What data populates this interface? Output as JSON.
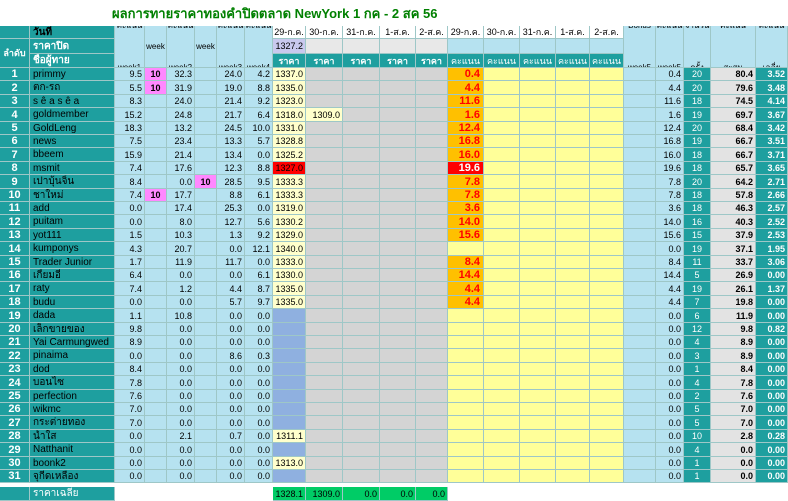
{
  "title": "ผลการทายราคาทองคำปิดตลาด NewYork 1 กค - 2 สค 56",
  "header": {
    "wanthi": "วันที่",
    "lamdap": "ลำดับ",
    "close_price": "ราคาปิด",
    "player_name": "ชื่อผู้ทาย",
    "score_week1": "คะแนน week1",
    "bonus_week2": "Bonus week 2",
    "score_week2": "คะแนน week2",
    "bonus_week3": "Bonus week 3",
    "score_week3": "คะแนน week3",
    "score_week4": "คะแนน week4",
    "bonus_week5": "Bonus week5",
    "score_week5": "คะแนน week5",
    "count": "จำนวนครั้ง",
    "total": "คะแนนสะสม",
    "avg": "คะแนนเฉลี่ย",
    "price_label": "ราคา",
    "points_label": "คะแนน",
    "dates": [
      "29-ก.ค.",
      "30-ก.ค.",
      "31-ก.ค.",
      "1-ส.ค.",
      "2-ส.ค."
    ],
    "close_values": [
      "1327.2",
      "",
      "",
      "",
      ""
    ]
  },
  "rows": [
    {
      "rank": "1",
      "name": "primmy",
      "w1": "9.5",
      "b2": "10",
      "w2": "32.3",
      "b3": "",
      "w3": "24.0",
      "w4": "4.2",
      "p": [
        "1337.0",
        "",
        "",
        "",
        ""
      ],
      "s": [
        "0.4",
        "",
        "",
        "",
        ""
      ],
      "w5": "0.4",
      "cnt": "20",
      "tot": "80.4",
      "avg": "3.52"
    },
    {
      "rank": "2",
      "name": "ตก-รถ",
      "w1": "5.5",
      "b2": "10",
      "w2": "31.9",
      "b3": "",
      "w3": "19.0",
      "w4": "8.8",
      "p": [
        "1335.0",
        "",
        "",
        "",
        ""
      ],
      "s": [
        "4.4",
        "",
        "",
        "",
        ""
      ],
      "w5": "4.4",
      "cnt": "20",
      "tot": "79.6",
      "avg": "3.48"
    },
    {
      "rank": "3",
      "name": "s ê a s ê a",
      "w1": "8.3",
      "b2": "",
      "w2": "24.0",
      "b3": "",
      "w3": "21.4",
      "w4": "9.2",
      "p": [
        "1323.0",
        "",
        "",
        "",
        ""
      ],
      "s": [
        "11.6",
        "",
        "",
        "",
        ""
      ],
      "w5": "11.6",
      "cnt": "18",
      "tot": "74.5",
      "avg": "4.14"
    },
    {
      "rank": "4",
      "name": "goldmember",
      "w1": "15.2",
      "b2": "",
      "w2": "24.8",
      "b3": "",
      "w3": "21.7",
      "w4": "6.4",
      "p": [
        "1318.0",
        "1309.0",
        "",
        "",
        ""
      ],
      "s": [
        "1.6",
        "",
        "",
        "",
        ""
      ],
      "w5": "1.6",
      "cnt": "19",
      "tot": "69.7",
      "avg": "3.67"
    },
    {
      "rank": "5",
      "name": "GoldLeng",
      "w1": "18.3",
      "b2": "",
      "w2": "13.2",
      "b3": "",
      "w3": "24.5",
      "w4": "10.0",
      "p": [
        "1331.0",
        "",
        "",
        "",
        ""
      ],
      "s": [
        "12.4",
        "",
        "",
        "",
        ""
      ],
      "w5": "12.4",
      "cnt": "20",
      "tot": "68.4",
      "avg": "3.42"
    },
    {
      "rank": "6",
      "name": "news",
      "w1": "7.5",
      "b2": "",
      "w2": "23.4",
      "b3": "",
      "w3": "13.3",
      "w4": "5.7",
      "p": [
        "1328.8",
        "",
        "",
        "",
        ""
      ],
      "s": [
        "16.8",
        "",
        "",
        "",
        ""
      ],
      "w5": "16.8",
      "cnt": "19",
      "tot": "66.7",
      "avg": "3.51"
    },
    {
      "rank": "7",
      "name": "bbeem",
      "w1": "15.9",
      "b2": "",
      "w2": "21.4",
      "b3": "",
      "w3": "13.4",
      "w4": "0.0",
      "p": [
        "1325.2",
        "",
        "",
        "",
        ""
      ],
      "s": [
        "16.0",
        "",
        "",
        "",
        ""
      ],
      "w5": "16.0",
      "cnt": "18",
      "tot": "66.7",
      "avg": "3.71"
    },
    {
      "rank": "8",
      "name": "msmit",
      "w1": "7.4",
      "b2": "",
      "w2": "17.6",
      "b3": "",
      "w3": "12.3",
      "w4": "8.8",
      "p": [
        "1327.0",
        "",
        "",
        "",
        ""
      ],
      "s": [
        "19.6",
        "",
        "",
        "",
        ""
      ],
      "w5": "19.6",
      "cnt": "18",
      "tot": "65.7",
      "avg": "3.65",
      "hit": true
    },
    {
      "rank": "9",
      "name": "เปาบุ้นจิ้น",
      "w1": "8.4",
      "b2": "",
      "w2": "0.0",
      "b3": "10",
      "w3": "28.5",
      "w4": "9.5",
      "p": [
        "1333.3",
        "",
        "",
        "",
        ""
      ],
      "s": [
        "7.8",
        "",
        "",
        "",
        ""
      ],
      "w5": "7.8",
      "cnt": "20",
      "tot": "64.2",
      "avg": "2.71"
    },
    {
      "rank": "10",
      "name": "ชาใหม่",
      "w1": "7.4",
      "b2": "10",
      "w2": "17.7",
      "b3": "",
      "w3": "8.8",
      "w4": "6.1",
      "p": [
        "1333.3",
        "",
        "",
        "",
        ""
      ],
      "s": [
        "7.8",
        "",
        "",
        "",
        ""
      ],
      "w5": "7.8",
      "cnt": "18",
      "tot": "57.8",
      "avg": "2.66"
    },
    {
      "rank": "11",
      "name": "add",
      "w1": "0.0",
      "b2": "",
      "w2": "17.4",
      "b3": "",
      "w3": "25.3",
      "w4": "0.0",
      "p": [
        "1319.0",
        "",
        "",
        "",
        ""
      ],
      "s": [
        "3.6",
        "",
        "",
        "",
        ""
      ],
      "w5": "3.6",
      "cnt": "18",
      "tot": "46.3",
      "avg": "2.57"
    },
    {
      "rank": "12",
      "name": "puitam",
      "w1": "0.0",
      "b2": "",
      "w2": "8.0",
      "b3": "",
      "w3": "12.7",
      "w4": "5.6",
      "p": [
        "1330.2",
        "",
        "",
        "",
        ""
      ],
      "s": [
        "14.0",
        "",
        "",
        "",
        ""
      ],
      "w5": "14.0",
      "cnt": "16",
      "tot": "40.3",
      "avg": "2.52"
    },
    {
      "rank": "13",
      "name": "yot111",
      "w1": "1.5",
      "b2": "",
      "w2": "10.3",
      "b3": "",
      "w3": "1.3",
      "w4": "9.2",
      "p": [
        "1329.0",
        "",
        "",
        "",
        ""
      ],
      "s": [
        "15.6",
        "",
        "",
        "",
        ""
      ],
      "w5": "15.6",
      "cnt": "15",
      "tot": "37.9",
      "avg": "2.53"
    },
    {
      "rank": "14",
      "name": "kumponys",
      "w1": "4.3",
      "b2": "",
      "w2": "20.7",
      "b3": "",
      "w3": "0.0",
      "w4": "12.1",
      "p": [
        "1340.0",
        "",
        "",
        "",
        ""
      ],
      "s": [
        "",
        "",
        "",
        "",
        ""
      ],
      "w5": "0.0",
      "cnt": "19",
      "tot": "37.1",
      "avg": "1.95"
    },
    {
      "rank": "15",
      "name": "Trader Junior",
      "w1": "1.7",
      "b2": "",
      "w2": "11.9",
      "b3": "",
      "w3": "11.7",
      "w4": "0.0",
      "p": [
        "1333.0",
        "",
        "",
        "",
        ""
      ],
      "s": [
        "8.4",
        "",
        "",
        "",
        ""
      ],
      "w5": "8.4",
      "cnt": "11",
      "tot": "33.7",
      "avg": "3.06"
    },
    {
      "rank": "16",
      "name": "เกี้ยมอี๋",
      "w1": "6.4",
      "b2": "",
      "w2": "0.0",
      "b3": "",
      "w3": "0.0",
      "w4": "6.1",
      "p": [
        "1330.0",
        "",
        "",
        "",
        ""
      ],
      "s": [
        "14.4",
        "",
        "",
        "",
        ""
      ],
      "w5": "14.4",
      "cnt": "5",
      "tot": "26.9",
      "avg": "0.00"
    },
    {
      "rank": "17",
      "name": "raty",
      "w1": "7.4",
      "b2": "",
      "w2": "1.2",
      "b3": "",
      "w3": "4.4",
      "w4": "8.7",
      "p": [
        "1335.0",
        "",
        "",
        "",
        ""
      ],
      "s": [
        "4.4",
        "",
        "",
        "",
        ""
      ],
      "w5": "4.4",
      "cnt": "19",
      "tot": "26.1",
      "avg": "1.37"
    },
    {
      "rank": "18",
      "name": "budu",
      "w1": "0.0",
      "b2": "",
      "w2": "0.0",
      "b3": "",
      "w3": "5.7",
      "w4": "9.7",
      "p": [
        "1335.0",
        "",
        "",
        "",
        ""
      ],
      "s": [
        "4.4",
        "",
        "",
        "",
        ""
      ],
      "w5": "4.4",
      "cnt": "7",
      "tot": "19.8",
      "avg": "0.00"
    },
    {
      "rank": "19",
      "name": "dada",
      "w1": "1.1",
      "b2": "",
      "w2": "10.8",
      "b3": "",
      "w3": "0.0",
      "w4": "0.0",
      "p": [
        "",
        "",
        "",
        "",
        ""
      ],
      "s": [
        "",
        "",
        "",
        "",
        ""
      ],
      "w5": "0.0",
      "cnt": "6",
      "tot": "11.9",
      "avg": "0.00"
    },
    {
      "rank": "20",
      "name": "เล็กขายของ",
      "w1": "9.8",
      "b2": "",
      "w2": "0.0",
      "b3": "",
      "w3": "0.0",
      "w4": "0.0",
      "p": [
        "",
        "",
        "",
        "",
        ""
      ],
      "s": [
        "",
        "",
        "",
        "",
        ""
      ],
      "w5": "0.0",
      "cnt": "12",
      "tot": "9.8",
      "avg": "0.82"
    },
    {
      "rank": "21",
      "name": "Yai Carmungwed",
      "w1": "8.9",
      "b2": "",
      "w2": "0.0",
      "b3": "",
      "w3": "0.0",
      "w4": "0.0",
      "p": [
        "",
        "",
        "",
        "",
        ""
      ],
      "s": [
        "",
        "",
        "",
        "",
        ""
      ],
      "w5": "0.0",
      "cnt": "4",
      "tot": "8.9",
      "avg": "0.00"
    },
    {
      "rank": "22",
      "name": "pinaima",
      "w1": "0.0",
      "b2": "",
      "w2": "0.0",
      "b3": "",
      "w3": "8.6",
      "w4": "0.3",
      "p": [
        "",
        "",
        "",
        "",
        ""
      ],
      "s": [
        "",
        "",
        "",
        "",
        ""
      ],
      "w5": "0.0",
      "cnt": "3",
      "tot": "8.9",
      "avg": "0.00"
    },
    {
      "rank": "23",
      "name": "dod",
      "w1": "8.4",
      "b2": "",
      "w2": "0.0",
      "b3": "",
      "w3": "0.0",
      "w4": "0.0",
      "p": [
        "",
        "",
        "",
        "",
        ""
      ],
      "s": [
        "",
        "",
        "",
        "",
        ""
      ],
      "w5": "0.0",
      "cnt": "1",
      "tot": "8.4",
      "avg": "0.00"
    },
    {
      "rank": "24",
      "name": "บอนไซ",
      "w1": "7.8",
      "b2": "",
      "w2": "0.0",
      "b3": "",
      "w3": "0.0",
      "w4": "0.0",
      "p": [
        "",
        "",
        "",
        "",
        ""
      ],
      "s": [
        "",
        "",
        "",
        "",
        ""
      ],
      "w5": "0.0",
      "cnt": "4",
      "tot": "7.8",
      "avg": "0.00"
    },
    {
      "rank": "25",
      "name": "perfection",
      "w1": "7.6",
      "b2": "",
      "w2": "0.0",
      "b3": "",
      "w3": "0.0",
      "w4": "0.0",
      "p": [
        "",
        "",
        "",
        "",
        ""
      ],
      "s": [
        "",
        "",
        "",
        "",
        ""
      ],
      "w5": "0.0",
      "cnt": "2",
      "tot": "7.6",
      "avg": "0.00"
    },
    {
      "rank": "26",
      "name": "wikmc",
      "w1": "7.0",
      "b2": "",
      "w2": "0.0",
      "b3": "",
      "w3": "0.0",
      "w4": "0.0",
      "p": [
        "",
        "",
        "",
        "",
        ""
      ],
      "s": [
        "",
        "",
        "",
        "",
        ""
      ],
      "w5": "0.0",
      "cnt": "5",
      "tot": "7.0",
      "avg": "0.00"
    },
    {
      "rank": "27",
      "name": "กระต่ายทอง",
      "w1": "7.0",
      "b2": "",
      "w2": "0.0",
      "b3": "",
      "w3": "0.0",
      "w4": "0.0",
      "p": [
        "",
        "",
        "",
        "",
        ""
      ],
      "s": [
        "",
        "",
        "",
        "",
        ""
      ],
      "w5": "0.0",
      "cnt": "5",
      "tot": "7.0",
      "avg": "0.00"
    },
    {
      "rank": "28",
      "name": "น้ำใส",
      "w1": "0.0",
      "b2": "",
      "w2": "2.1",
      "b3": "",
      "w3": "0.7",
      "w4": "0.0",
      "p": [
        "1311.1",
        "",
        "",
        "",
        ""
      ],
      "s": [
        "",
        "",
        "",
        "",
        ""
      ],
      "w5": "0.0",
      "cnt": "10",
      "tot": "2.8",
      "avg": "0.28"
    },
    {
      "rank": "29",
      "name": "Natthanit",
      "w1": "0.0",
      "b2": "",
      "w2": "0.0",
      "b3": "",
      "w3": "0.0",
      "w4": "0.0",
      "p": [
        "",
        "",
        "",
        "",
        ""
      ],
      "s": [
        "",
        "",
        "",
        "",
        ""
      ],
      "w5": "0.0",
      "cnt": "4",
      "tot": "0.0",
      "avg": "0.00"
    },
    {
      "rank": "30",
      "name": "boonk2",
      "w1": "0.0",
      "b2": "",
      "w2": "0.0",
      "b3": "",
      "w3": "0.0",
      "w4": "0.0",
      "p": [
        "1313.0",
        "",
        "",
        "",
        ""
      ],
      "s": [
        "",
        "",
        "",
        "",
        ""
      ],
      "w5": "0.0",
      "cnt": "1",
      "tot": "0.0",
      "avg": "0.00"
    },
    {
      "rank": "31",
      "name": "จุกีดเหลือง",
      "w1": "0.0",
      "b2": "",
      "w2": "0.0",
      "b3": "",
      "w3": "0.0",
      "w4": "0.0",
      "p": [
        "",
        "",
        "",
        "",
        ""
      ],
      "s": [
        "",
        "",
        "",
        "",
        ""
      ],
      "w5": "0.0",
      "cnt": "1",
      "tot": "0.0",
      "avg": "0.00"
    }
  ],
  "footer": {
    "label": "ราคาเฉลี่ย",
    "values": [
      "1328.1",
      "1309.0",
      "0.0",
      "0.0",
      "0.0"
    ]
  },
  "colors": {
    "teal": "#1e9f9f",
    "header_teal": "#b6e2f0",
    "lavender": "#c9c9ee",
    "price_blue": "#8fb0e0",
    "price_gray": "#d4d4d4",
    "score_yellow": "#ffff99",
    "score_orange": "#ffc000",
    "bonus_pink": "#ff88ff",
    "hit_red": "#ff0000",
    "footer_green": "#00cc66",
    "total_gray": "#e3e3e3",
    "title_green": "#008000"
  }
}
